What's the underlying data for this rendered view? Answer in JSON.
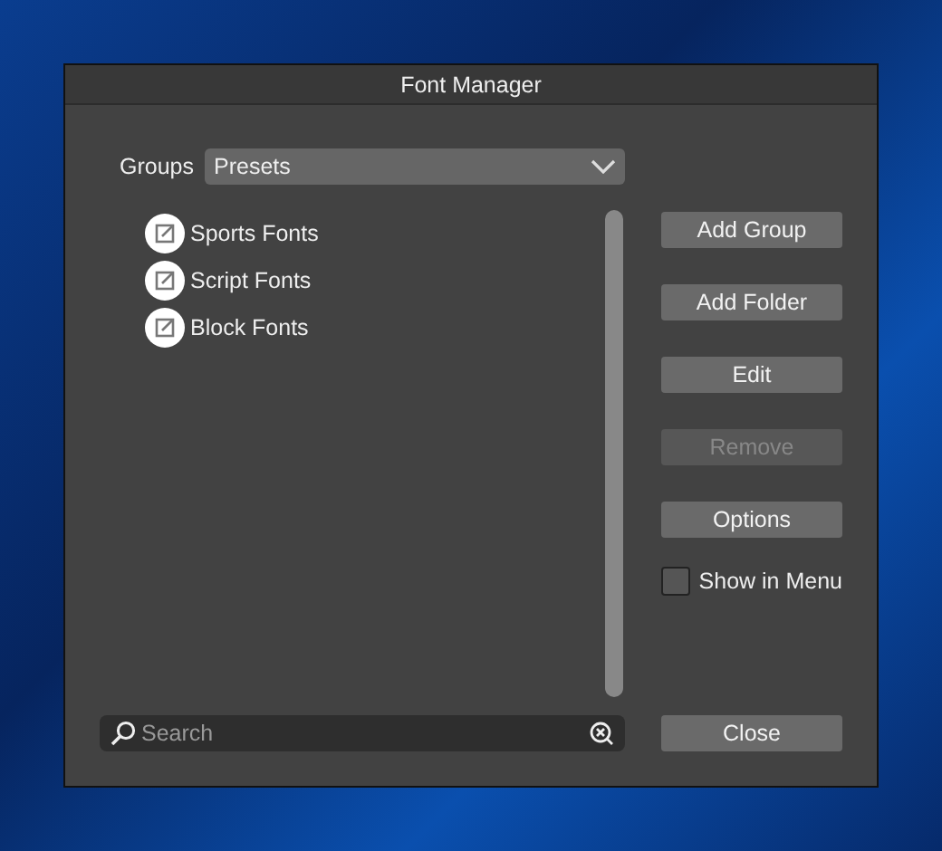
{
  "window": {
    "title": "Font Manager"
  },
  "groups": {
    "label": "Groups",
    "value": "Presets"
  },
  "font_groups": [
    {
      "label": "Sports Fonts"
    },
    {
      "label": "Script Fonts"
    },
    {
      "label": "Block Fonts"
    }
  ],
  "buttons": [
    {
      "label": "Add Group",
      "disabled": false
    },
    {
      "label": "Add Folder",
      "disabled": false
    },
    {
      "label": "Edit",
      "disabled": false
    },
    {
      "label": "Remove",
      "disabled": true
    },
    {
      "label": "Options",
      "disabled": false
    }
  ],
  "show_in_menu": {
    "label": "Show in Menu",
    "checked": false
  },
  "search": {
    "placeholder": "Search"
  },
  "close_button": "Close"
}
